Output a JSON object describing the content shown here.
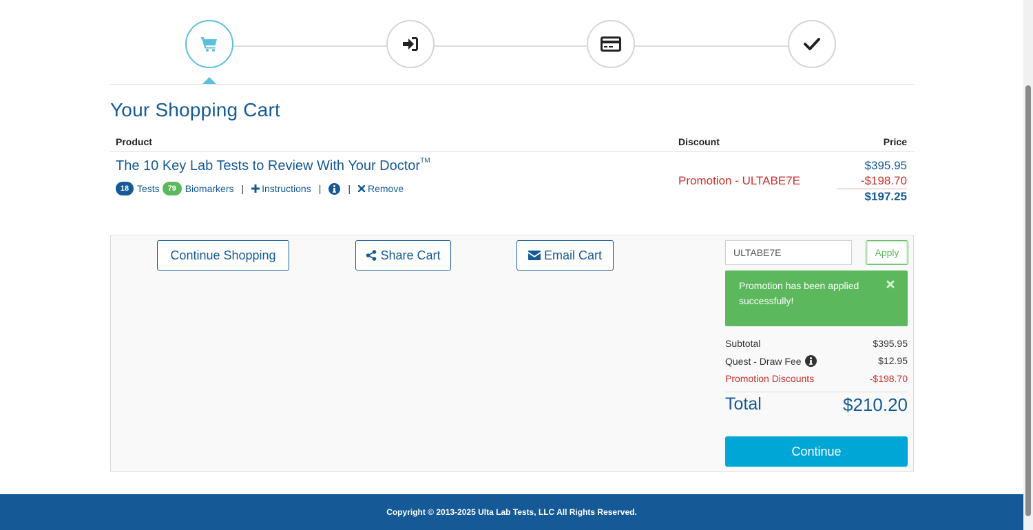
{
  "steps": [
    {
      "name": "cart",
      "icon": "shopping-cart-icon",
      "active": true
    },
    {
      "name": "sign-in",
      "icon": "sign-in-icon",
      "active": false
    },
    {
      "name": "payment",
      "icon": "credit-card-icon",
      "active": false
    },
    {
      "name": "confirm",
      "icon": "checkmark-icon",
      "active": false
    }
  ],
  "page_title": "Your Shopping Cart",
  "table": {
    "headers": {
      "product": "Product",
      "discount": "Discount",
      "price": "Price"
    }
  },
  "item": {
    "name": "The 10 Key Lab Tests to Review With Your Doctor",
    "trademark": "TM",
    "tests_count": "18",
    "tests_label": "Tests",
    "biomarkers_count": "79",
    "biomarkers_label": "Biomarkers",
    "instructions_label": "Instructions",
    "remove_label": "Remove",
    "discount": "Promotion - ULTABE7E",
    "price_original": "$395.95",
    "price_discount": "-$198.70",
    "price_final": "$197.25"
  },
  "actions": {
    "continue_shopping": "Continue Shopping",
    "share_cart": "Share Cart",
    "email_cart": "Email Cart"
  },
  "promo": {
    "code_value": "ULTABE7E",
    "apply_label": "Apply",
    "success_message": "Promotion has been applied successfully!"
  },
  "summary": {
    "subtotal_label": "Subtotal",
    "subtotal_value": "$395.95",
    "draw_fee_label": "Quest - Draw Fee",
    "draw_fee_value": "$12.95",
    "promo_label": "Promotion Discounts",
    "promo_value": "-$198.70",
    "total_label": "Total",
    "total_value": "$210.20"
  },
  "continue_label": "Continue",
  "footer_text": "Copyright © 2013-2025 Ulta Lab Tests, LLC All Rights Reserved.",
  "colors": {
    "brand_blue": "#155a96",
    "active_step": "#5bc0de",
    "success_green": "#5cb85c",
    "danger_red": "#c9302c",
    "cta_blue": "#00a6d6"
  }
}
